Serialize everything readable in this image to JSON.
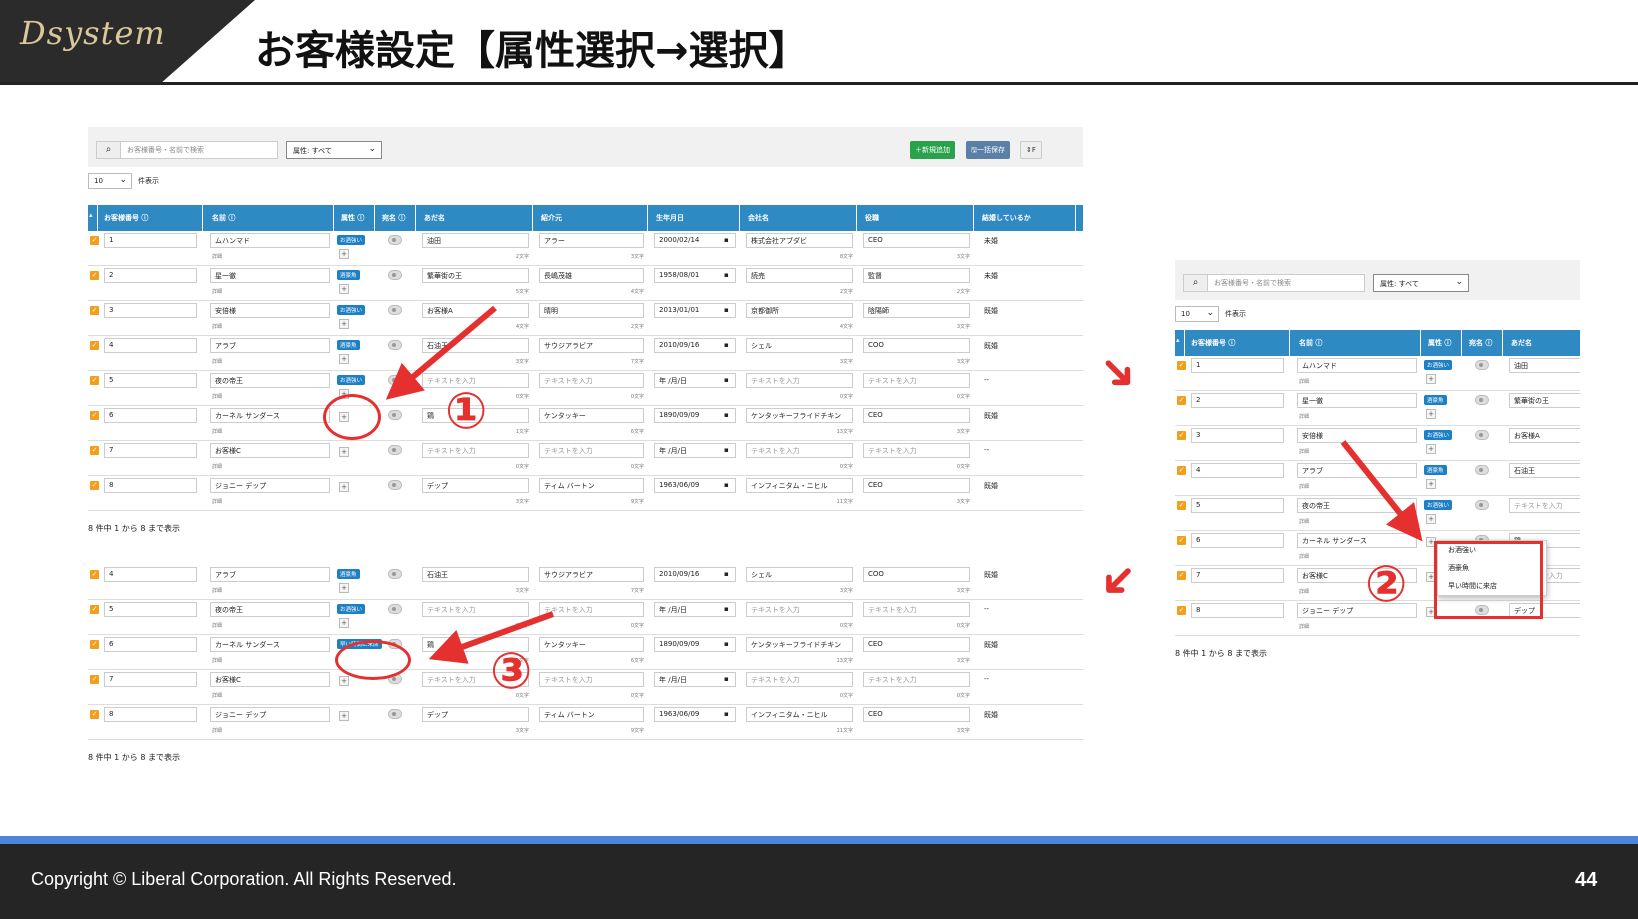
{
  "header": {
    "logo": "Dsystem",
    "title": "お客様設定【属性選択→選択】"
  },
  "footer": {
    "copyright": "Copyright ©  Liberal Corporation. All Rights Reserved.",
    "page_number": "44"
  },
  "toolbar": {
    "search_placeholder": "お客様番号・名前で検索",
    "attr_filter": "属性: すべて",
    "add_label": "＋新規追加",
    "save_label": "🖫一括保存",
    "more_label": "⇕F"
  },
  "per_page": {
    "value": "10",
    "label": "件表示"
  },
  "columns": [
    "お客様番号 ⓘ",
    "名前 ⓘ",
    "属性 ⓘ",
    "宛名 ⓘ",
    "あだ名",
    "紹介元",
    "生年月日",
    "会社名",
    "役職",
    "結婚しているか"
  ],
  "rows": [
    {
      "id": "1",
      "name": "ムハンマド",
      "attr": "お酒強い",
      "nick": "油田",
      "nick_cnt": "2文字",
      "ref": "アラー",
      "ref_cnt": "3文字",
      "birth": "2000/02/14",
      "company": "株式会社アブダビ",
      "company_cnt": "8文字",
      "role": "CEO",
      "role_cnt": "3文字",
      "married": "未婚"
    },
    {
      "id": "2",
      "name": "星一徹",
      "attr": "酒豪魚",
      "nick": "繁華街の王",
      "nick_cnt": "5文字",
      "ref": "長嶋茂雄",
      "ref_cnt": "4文字",
      "birth": "1958/08/01",
      "company": "読売",
      "company_cnt": "2文字",
      "role": "監督",
      "role_cnt": "2文字",
      "married": "未婚"
    },
    {
      "id": "3",
      "name": "安倍様",
      "attr": "お酒強い",
      "nick": "お客様A",
      "nick_cnt": "4文字",
      "ref": "晴明",
      "ref_cnt": "2文字",
      "birth": "2013/01/01",
      "company": "京都御所",
      "company_cnt": "4文字",
      "role": "陰陽師",
      "role_cnt": "3文字",
      "married": "既婚"
    },
    {
      "id": "4",
      "name": "アラブ",
      "attr": "酒豪魚",
      "nick": "石油王",
      "nick_cnt": "3文字",
      "ref": "サウジアラビア",
      "ref_cnt": "7文字",
      "birth": "2010/09/16",
      "company": "シェル",
      "company_cnt": "3文字",
      "role": "COO",
      "role_cnt": "3文字",
      "married": "既婚"
    },
    {
      "id": "5",
      "name": "夜の帝王",
      "attr": "お酒強い",
      "nick": "テキストを入力",
      "nick_cnt": "0文字",
      "ref": "テキストを入力",
      "ref_cnt": "0文字",
      "birth": "年 /月/日",
      "company": "テキストを入力",
      "company_cnt": "0文字",
      "role": "テキストを入力",
      "role_cnt": "0文字",
      "married": "--"
    },
    {
      "id": "6",
      "name": "カーネル サンダース",
      "attr": "",
      "nick": "鶏",
      "nick_cnt": "1文字",
      "ref": "ケンタッキー",
      "ref_cnt": "6文字",
      "birth": "1890/09/09",
      "company": "ケンタッキーフライドチキン",
      "company_cnt": "13文字",
      "role": "CEO",
      "role_cnt": "3文字",
      "married": "既婚"
    },
    {
      "id": "7",
      "name": "お客様C",
      "attr": "",
      "nick": "テキストを入力",
      "nick_cnt": "0文字",
      "ref": "テキストを入力",
      "ref_cnt": "0文字",
      "birth": "年 /月/日",
      "company": "テキストを入力",
      "company_cnt": "0文字",
      "role": "テキストを入力",
      "role_cnt": "0文字",
      "married": "--"
    },
    {
      "id": "8",
      "name": "ジョニー デップ",
      "attr": "",
      "nick": "デップ",
      "nick_cnt": "3文字",
      "ref": "ティム バートン",
      "ref_cnt": "9文字",
      "birth": "1963/06/09",
      "company": "インフィニタム・ニヒル",
      "company_cnt": "11文字",
      "role": "CEO",
      "role_cnt": "3文字",
      "married": "既婚"
    }
  ],
  "detail_label": "詳細",
  "page_info": "8 件中 1 から 8 まで表示",
  "dropdown": [
    "お酒強い",
    "酒豪魚",
    "早い時間に来店"
  ],
  "selected_attr": "早い時間に来店",
  "step_labels": [
    "①",
    "②",
    "③"
  ],
  "colors": {
    "accent": "#2f8ac4",
    "annotation": "#e53030",
    "checkbox": "#f2a01c"
  }
}
